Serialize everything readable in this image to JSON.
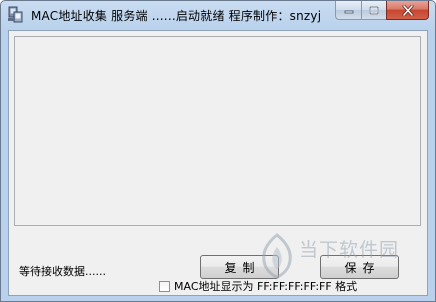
{
  "window": {
    "title": "MAC地址收集 服务端 ......启动就绪    程序制作：snzyj",
    "minimize_label": "minimize",
    "maximize_label": "maximize",
    "close_label": "close"
  },
  "main": {
    "log_text": "",
    "status": "等待接收数据......",
    "copy_button": "复制",
    "save_button": "保存",
    "format_checkbox": {
      "label": "MAC地址显示为 FF:FF:FF:FF:FF 格式",
      "checked": false
    }
  },
  "watermark": {
    "text": "当下软件园"
  },
  "colors": {
    "title_bar": "#b9d1ec",
    "client_bg": "#f0f0f0",
    "close_button": "#c6462f"
  }
}
